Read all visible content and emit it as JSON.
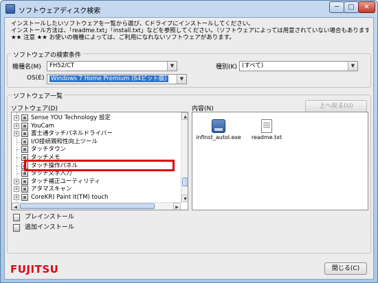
{
  "window": {
    "title": "ソフトウェアディスク検索",
    "minimize": "─",
    "maximize": "□",
    "close": "✕"
  },
  "intro": {
    "line1": "インストールしたいソフトウェアを一覧から選び、Cドライブにインストールしてください。",
    "line2": "インストール方法は、「readme.txt」「install.txt」などを参照してください。（ソフトウェアによっては用意されていない場合もあります）",
    "line3": "★★ 注意 ★★ お使いの機種によっては、ご利用になれないソフトウェアがあります。"
  },
  "search": {
    "group_label": "ソフトウェアの検索条件",
    "model_label": "機種名(M)",
    "model_value": "FH52/CT",
    "type_label": "種別(K)",
    "type_value": "(すべて)",
    "os_label": "OS(E)",
    "os_value": "Windows 7 Home Premium (64ビット版)"
  },
  "list": {
    "group_label": "ソフトウェア一覧",
    "software_label": "ソフトウェア(D)",
    "contents_label": "内容(N)",
    "up_button": "上へ戻る(U)",
    "items": [
      {
        "label": "Sense YOU Technology 設定",
        "expander": "+"
      },
      {
        "label": "YouCam",
        "expander": "+"
      },
      {
        "label": "富士通タッチパネルドライバー",
        "expander": "+"
      },
      {
        "label": "I/O接続親和性向上ツール",
        "expander": ""
      },
      {
        "label": "タッチタウン",
        "expander": ""
      },
      {
        "label": "タッチメモ",
        "expander": ""
      },
      {
        "label": "タッチ操作パネル",
        "expander": ""
      },
      {
        "label": "タッチ文字入力",
        "expander": ""
      },
      {
        "label": "タッチ補正ユーティリティ",
        "expander": "+"
      },
      {
        "label": "アタマスキャン",
        "expander": "+"
      },
      {
        "label": "CoreKR) Paint it(TM) touch",
        "expander": "+"
      }
    ],
    "files": [
      {
        "name": "infinst_autol.exe",
        "icon": "exe-installer-icon"
      },
      {
        "name": "readme.txt",
        "icon": "text-file-icon"
      }
    ]
  },
  "actions": {
    "preinstall": "プレインストール",
    "add_install": "追加インストール"
  },
  "footer": {
    "logo": "FUJITSU",
    "close_button": "閉じる(C)"
  },
  "colors": {
    "selection": "#3173c9",
    "highlight_box": "#e00000",
    "logo_red": "#e2001a"
  }
}
